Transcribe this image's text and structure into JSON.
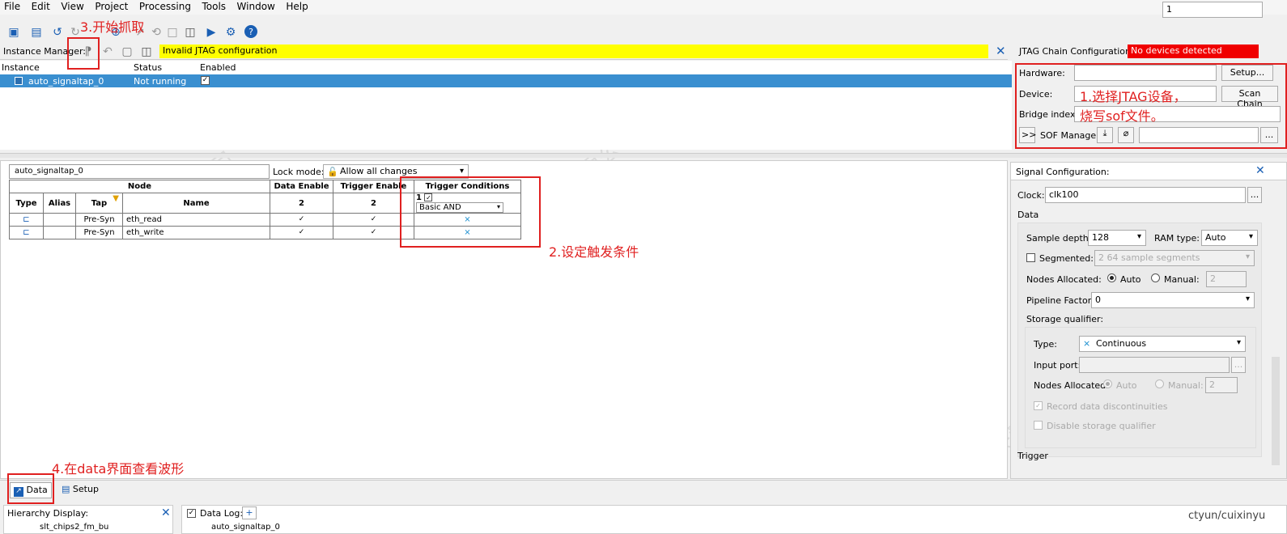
{
  "menu": [
    "File",
    "Edit",
    "View",
    "Project",
    "Processing",
    "Tools",
    "Window",
    "Help"
  ],
  "top_right_value": "1",
  "instance_manager": {
    "label": "Instance Manager:",
    "status_message": "Invalid JTAG configuration",
    "columns": [
      "Instance",
      "Status",
      "Enabled"
    ],
    "rows": [
      {
        "instance": "auto_signaltap_0",
        "status": "Not running",
        "enabled": "✓"
      }
    ]
  },
  "jtag": {
    "label": "JTAG Chain Configuration:",
    "status": "No devices detected",
    "hardware_label": "Hardware:",
    "setup_button": "Setup...",
    "device_label": "Device:",
    "scan_button": "Scan Chain",
    "bridge_label": "Bridge index:",
    "expand_button": ">>",
    "sof_label": "SOF Manager:",
    "more_button": "..."
  },
  "node_panel": {
    "instance_name": "auto_signaltap_0",
    "lock_label": "Lock mode:",
    "lock_value": "Allow all changes",
    "header_node": "Node",
    "header_data_enable": "Data Enable",
    "header_trigger_enable": "Trigger Enable",
    "header_trigger_conditions": "Trigger Conditions",
    "col_type": "Type",
    "col_alias": "Alias",
    "col_tap": "Tap",
    "col_name": "Name",
    "data_enable_count": "2",
    "trigger_enable_count": "2",
    "trigger_index": "1",
    "trigger_check": "✓",
    "trigger_mode": "Basic AND",
    "rows": [
      {
        "tap": "Pre-Syn",
        "name": "eth_read",
        "data": "✓",
        "trigger": "✓"
      },
      {
        "tap": "Pre-Syn",
        "name": "eth_write",
        "data": "✓",
        "trigger": "✓"
      }
    ]
  },
  "signal_config": {
    "title": "Signal Configuration:",
    "clock_label": "Clock:",
    "clock_value": "clk100",
    "clock_btn": "...",
    "data_section": "Data",
    "sample_depth_label": "Sample depth:",
    "sample_depth_value": "128",
    "ram_type_label": "RAM type:",
    "ram_type_value": "Auto",
    "segmented_label": "Segmented:",
    "segmented_value": "2  64 sample segments",
    "nodes_alloc_label": "Nodes Allocated:",
    "auto_label": "Auto",
    "manual_label": "Manual:",
    "manual_value": "2",
    "pipeline_label": "Pipeline Factor:",
    "pipeline_value": "0",
    "storage_label": "Storage qualifier:",
    "type_label": "Type:",
    "type_value": "Continuous",
    "input_port_label": "Input port:",
    "input_port_btn": "...",
    "nodes_alloc2_label": "Nodes Allocated:",
    "auto2_label": "Auto",
    "manual2_label": "Manual:",
    "manual2_value": "2",
    "record_label": "Record data discontinuities",
    "disable_label": "Disable storage qualifier",
    "trigger_section": "Trigger"
  },
  "tabs": {
    "data": "Data",
    "setup": "Setup"
  },
  "hierarchy": {
    "label": "Hierarchy Display:",
    "item": "slt_chips2_fm_bu"
  },
  "datalog": {
    "label": "Data Log:",
    "item": "auto_signaltap_0"
  },
  "annotations": {
    "a1_line1": "1.选择JTAG设备，",
    "a1_line2": "烧写sof文件。",
    "a2": "2.设定触发条件",
    "a3": "3.开始抓取",
    "a4": "4.在data界面查看波形"
  },
  "watermark": {
    "company": "天翼云科技有限公司",
    "person": "崔心宇 17310271965"
  },
  "footer_credit": "ctyun/cuixinyu"
}
